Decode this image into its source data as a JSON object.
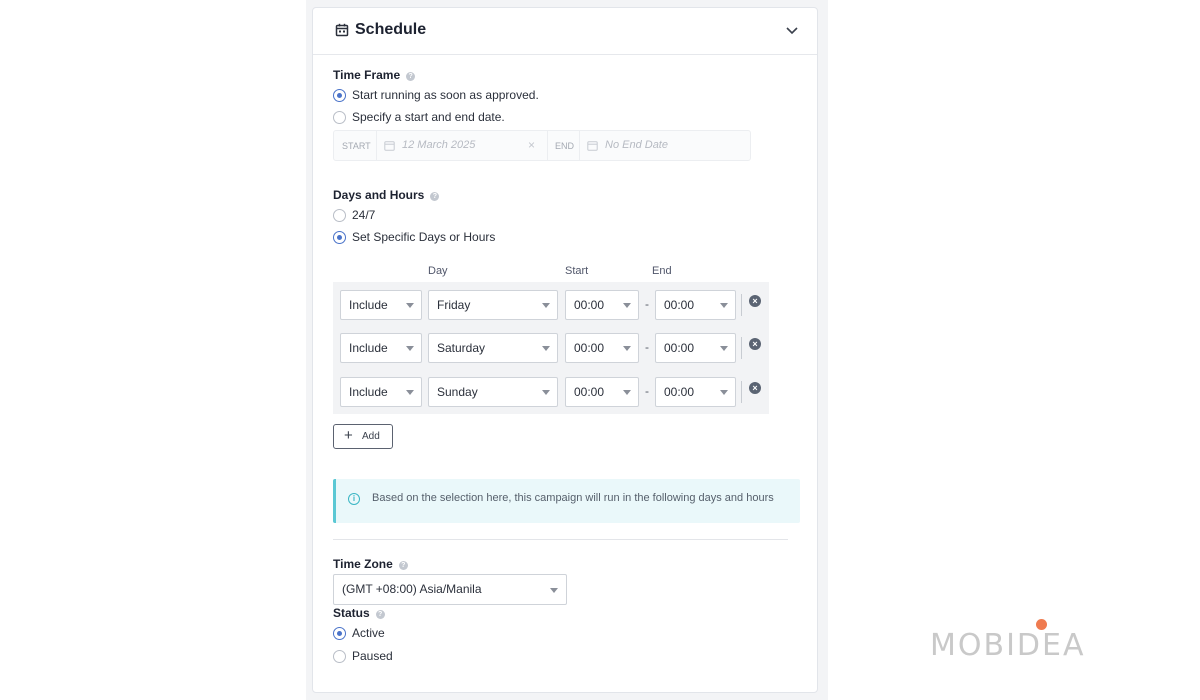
{
  "header": {
    "title": "Schedule"
  },
  "time_frame": {
    "label": "Time Frame",
    "options": [
      "Start running as soon as approved.",
      "Specify a start and end date."
    ],
    "selected": 0,
    "start_tag": "START",
    "start_value": "12 March 2025",
    "clear": "×",
    "end_tag": "END",
    "end_placeholder": "No End Date"
  },
  "days_hours": {
    "label": "Days and Hours",
    "options": [
      "24/7",
      "Set Specific Days or Hours"
    ],
    "selected": 1,
    "columns": {
      "day": "Day",
      "start": "Start",
      "end": "End"
    },
    "rows": [
      {
        "mode": "Include",
        "day": "Friday",
        "start": "00:00",
        "end": "00:00"
      },
      {
        "mode": "Include",
        "day": "Saturday",
        "start": "00:00",
        "end": "00:00"
      },
      {
        "mode": "Include",
        "day": "Sunday",
        "start": "00:00",
        "end": "00:00"
      }
    ],
    "range_separator": "-",
    "add_label": "Add"
  },
  "info": {
    "text": "Based on the selection here, this campaign will run in the following days and hours"
  },
  "timezone": {
    "label": "Time Zone",
    "value": "(GMT +08:00) Asia/Manila"
  },
  "status": {
    "label": "Status",
    "options": [
      "Active",
      "Paused"
    ],
    "selected": 0
  },
  "branding": {
    "logo": "MOBIDEA",
    "accent": "#ef7b50"
  },
  "colors": {
    "radio_accent": "#4a73c9",
    "info_accent": "#5bc8d4"
  }
}
